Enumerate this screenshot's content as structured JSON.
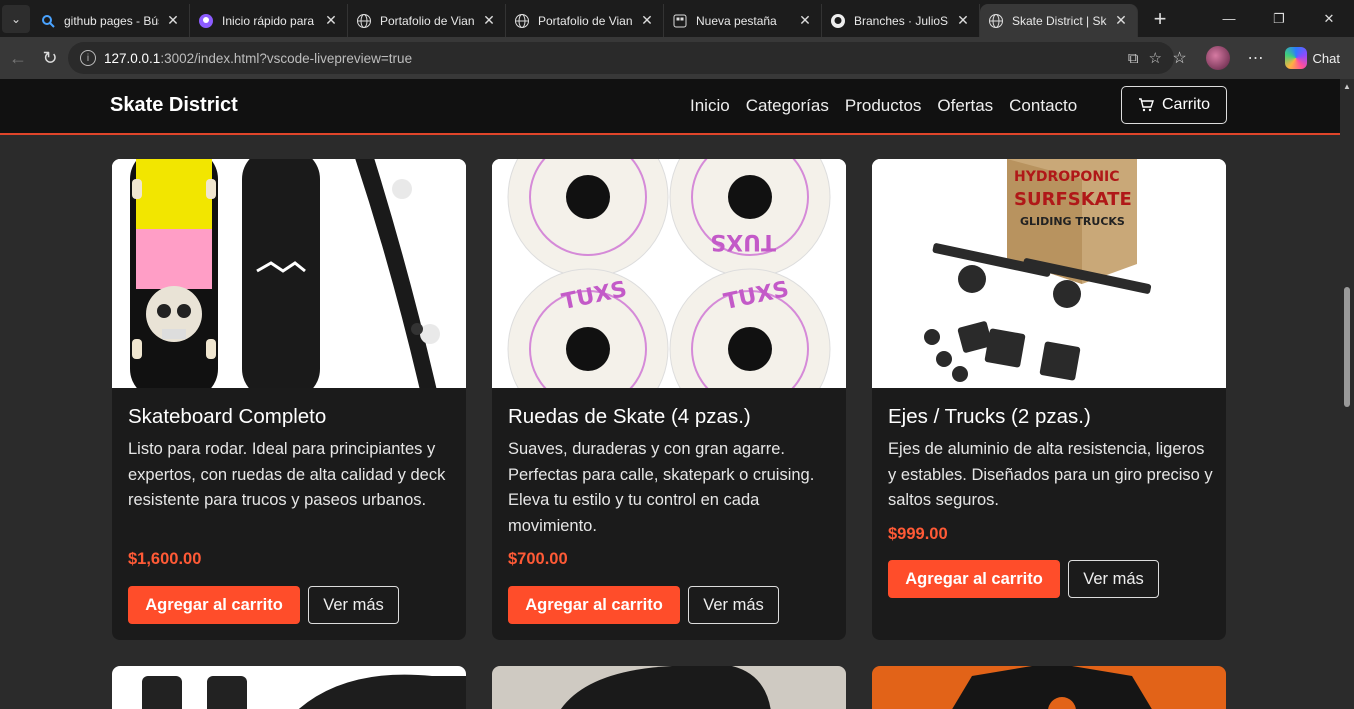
{
  "browser": {
    "tabs": [
      {
        "title": "github pages - Búsqueda",
        "icon": "search-icon"
      },
      {
        "title": "Inicio rápido para páginas",
        "icon": "github-pages-icon"
      },
      {
        "title": "Portafolio de Vianey",
        "icon": "globe-icon"
      },
      {
        "title": "Portafolio de Vianey",
        "icon": "globe-icon"
      },
      {
        "title": "Nueva pestaña",
        "icon": "new-tab-icon"
      },
      {
        "title": "Branches · JulioSMC",
        "icon": "github-icon"
      },
      {
        "title": "Skate District | Skate",
        "icon": "globe-icon"
      }
    ],
    "url_host": "127.0.0.1",
    "url_path": ":3002/index.html?vscode-livepreview=true",
    "chat_label": "Chat"
  },
  "site": {
    "brand": "Skate District",
    "nav": [
      "Inicio",
      "Categorías",
      "Productos",
      "Ofertas",
      "Contacto"
    ],
    "cart_label": "Carrito",
    "accent": "#ff4d2a"
  },
  "products": [
    {
      "title": "Skateboard Completo",
      "desc": "Listo para rodar. Ideal para principiantes y expertos, con ruedas de alta calidad y deck resistente para trucos y paseos urbanos.",
      "price": "$1,600.00",
      "add_label": "Agregar al carrito",
      "more_label": "Ver más"
    },
    {
      "title": "Ruedas de Skate (4 pzas.)",
      "desc": "Suaves, duraderas y con gran agarre. Perfectas para calle, skatepark o cruising. Eleva tu estilo y tu control en cada movimiento.",
      "price": "$700.00",
      "add_label": "Agregar al carrito",
      "more_label": "Ver más",
      "image_text": "TUXS"
    },
    {
      "title": "Ejes / Trucks (2 pzas.)",
      "desc": "Ejes de aluminio de alta resistencia, ligeros y estables. Diseñados para un giro preciso y saltos seguros.",
      "price": "$999.00",
      "add_label": "Agregar al carrito",
      "more_label": "Ver más",
      "image_text": [
        "HYDROPONIC",
        "SURFSKATE",
        "GLIDING TRUCKS"
      ]
    }
  ]
}
